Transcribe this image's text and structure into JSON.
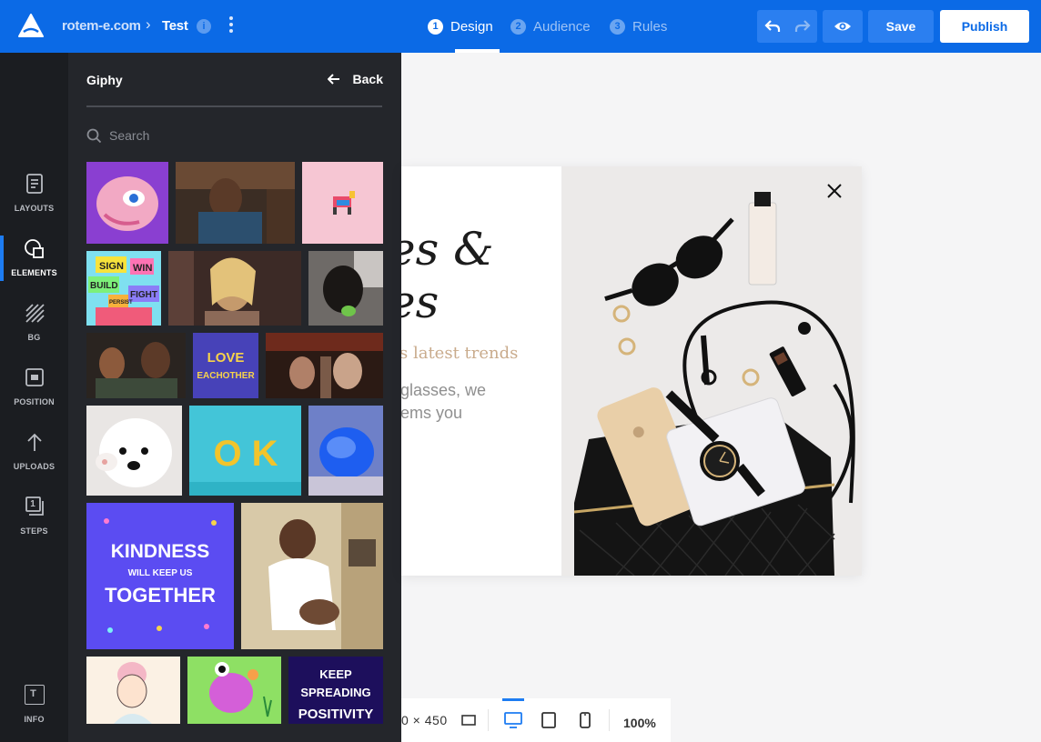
{
  "header": {
    "site": "rotem-e.com",
    "page": "Test",
    "info_badge": "i",
    "steps": [
      {
        "num": "1",
        "label": "Design"
      },
      {
        "num": "2",
        "label": "Audience"
      },
      {
        "num": "3",
        "label": "Rules"
      }
    ],
    "save_label": "Save",
    "publish_label": "Publish",
    "brand_color": "#0b6ae6"
  },
  "sidebar": {
    "items": [
      {
        "label": "LAYOUTS",
        "icon": "layouts-icon"
      },
      {
        "label": "ELEMENTS",
        "icon": "elements-icon",
        "active": true
      },
      {
        "label": "BG",
        "icon": "bg-icon"
      },
      {
        "label": "POSITION",
        "icon": "position-icon"
      },
      {
        "label": "UPLOADS",
        "icon": "upload-icon"
      },
      {
        "label": "STEPS",
        "icon": "steps-icon",
        "badge": "1"
      },
      {
        "label": "INFO",
        "icon": "info-icon",
        "badge": "T"
      }
    ]
  },
  "panel": {
    "title": "Giphy",
    "back_label": "Back",
    "search_placeholder": "Search",
    "gif_texts": {
      "sign": [
        "SIGN",
        "WIN",
        "BUILD",
        "FIGHT",
        "PERSIST"
      ],
      "love": [
        "LOVE",
        "EACHOTHER"
      ],
      "ok": "O K",
      "kindness": [
        "KINDNESS",
        "WILL KEEP US",
        "TOGETHER"
      ],
      "keep": [
        "KEEP",
        "SPREADING",
        "POSITIVITY"
      ]
    }
  },
  "canvas": {
    "headline": [
      "es &",
      "es"
    ],
    "subhead": "s latest trends",
    "body": [
      "glasses, we",
      "ems you"
    ]
  },
  "bottom": {
    "dims": "0 × 450",
    "zoom": "100%"
  }
}
